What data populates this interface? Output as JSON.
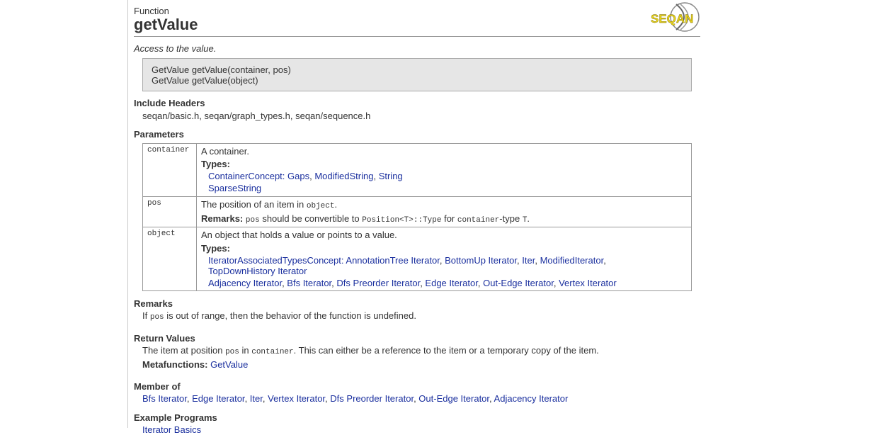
{
  "header": {
    "kind": "Function",
    "title": "getValue",
    "logo_text": "SEQAN"
  },
  "description": "Access to the value.",
  "signatures": [
    "GetValue getValue(container, pos)",
    "GetValue getValue(object)"
  ],
  "include": {
    "heading": "Include Headers",
    "text": "seqan/basic.h, seqan/graph_types.h, seqan/sequence.h"
  },
  "parameters": {
    "heading": "Parameters",
    "types_label": "Types:",
    "container": {
      "name": "container",
      "desc": "A container.",
      "concept": "ContainerConcept:",
      "links1": [
        "Gaps",
        "ModifiedString",
        "String"
      ],
      "links2": [
        "SparseString"
      ]
    },
    "pos": {
      "name": "pos",
      "desc_a": "The position of an item in ",
      "desc_code": "object",
      "desc_b": ".",
      "remarks_label": "Remarks:",
      "rem_code1": "pos",
      "rem_t1": " should be convertible to ",
      "rem_code2": "Position<T>::Type",
      "rem_t2": " for ",
      "rem_code3": "container",
      "rem_t3": "-type ",
      "rem_code4": "T",
      "rem_t4": "."
    },
    "object": {
      "name": "object",
      "desc": "An object that holds a value or points to a value.",
      "concept": "IteratorAssociatedTypesConcept:",
      "links1": [
        "AnnotationTree Iterator",
        "BottomUp Iterator",
        "Iter",
        "ModifiedIterator"
      ],
      "links2": [
        "TopDownHistory Iterator"
      ],
      "links3": [
        "Adjacency Iterator",
        "Bfs Iterator",
        "Dfs Preorder Iterator",
        "Edge Iterator",
        "Out-Edge Iterator",
        "Vertex Iterator"
      ]
    }
  },
  "remarks": {
    "heading": "Remarks",
    "t1": "If ",
    "code": "pos",
    "t2": " is out of range, then the behavior of the function is undefined."
  },
  "return_values": {
    "heading": "Return Values",
    "t1": "The item at position ",
    "code1": "pos",
    "t2": " in ",
    "code2": "container",
    "t3": ". This can either be a reference to the item or a temporary copy of the item.",
    "meta_label": "Metafunctions:",
    "meta_link": "GetValue"
  },
  "member_of": {
    "heading": "Member of",
    "links": [
      "Bfs Iterator",
      "Edge Iterator",
      "Iter",
      "Vertex Iterator",
      "Dfs Preorder Iterator",
      "Out-Edge Iterator",
      "Adjacency Iterator"
    ]
  },
  "example_programs": {
    "heading": "Example Programs",
    "partial_link": "Iterator Basics"
  }
}
